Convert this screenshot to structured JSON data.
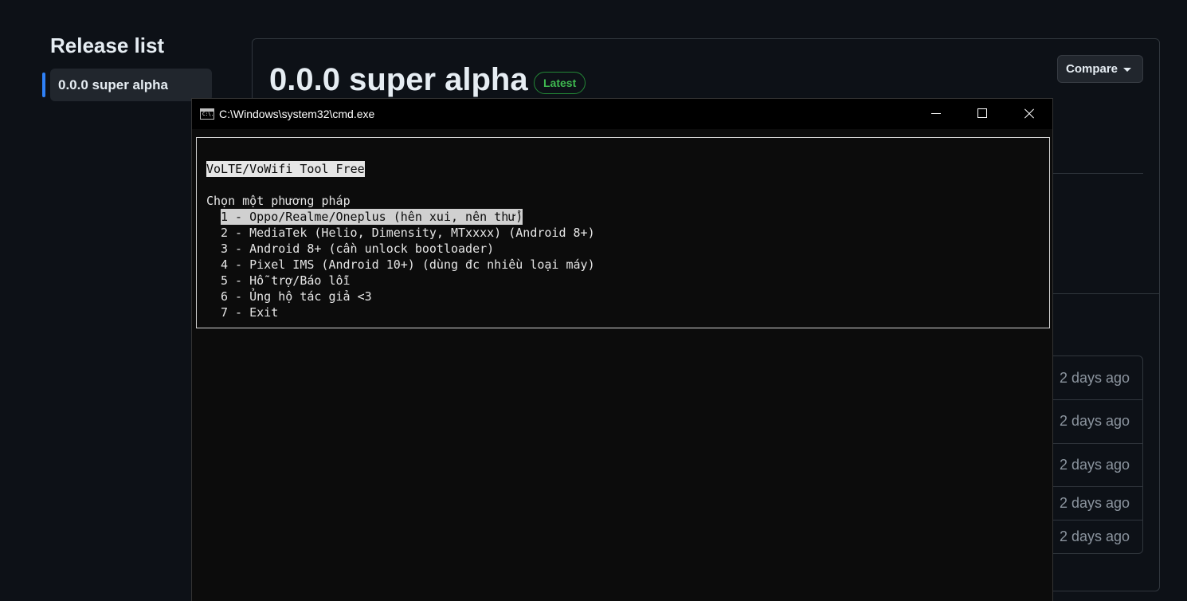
{
  "sidebar": {
    "title": "Release list",
    "items": [
      {
        "label": "0.0.0 super alpha",
        "active": true
      }
    ]
  },
  "release": {
    "title": "0.0.0 super alpha",
    "badge": "Latest",
    "compare_label": "Compare",
    "assets": [
      {
        "time": "2 days ago"
      },
      {
        "time": "2 days ago"
      },
      {
        "time": "2 days ago"
      },
      {
        "time": "2 days ago"
      },
      {
        "time": "2 days ago"
      }
    ]
  },
  "cmd": {
    "title": "C:\\Windows\\system32\\cmd.exe",
    "icon_label": "C:\\.",
    "banner": "VoLTE/VoWifi Tool Free",
    "prompt": "Chọn một phương pháp",
    "options": [
      "1 - Oppo/Realme/Oneplus (hên xui, nên thử)",
      "2 - MediaTek (Helio, Dimensity, MTxxxx) (Android 8+)",
      "3 - Android 8+ (cần unlock bootloader)",
      "4 - Pixel IMS (Android 10+) (dùng đc nhiều loại máy)",
      "5 - Hỗ trợ/Báo lỗi",
      "6 - Ủng hộ tác giả <3",
      "7 - Exit"
    ],
    "selected_index": 0
  },
  "colors": {
    "page_bg": "#0d1117",
    "accent": "#2f81f7",
    "latest_green": "#3fb950",
    "console_bg": "#0c0c0c"
  }
}
